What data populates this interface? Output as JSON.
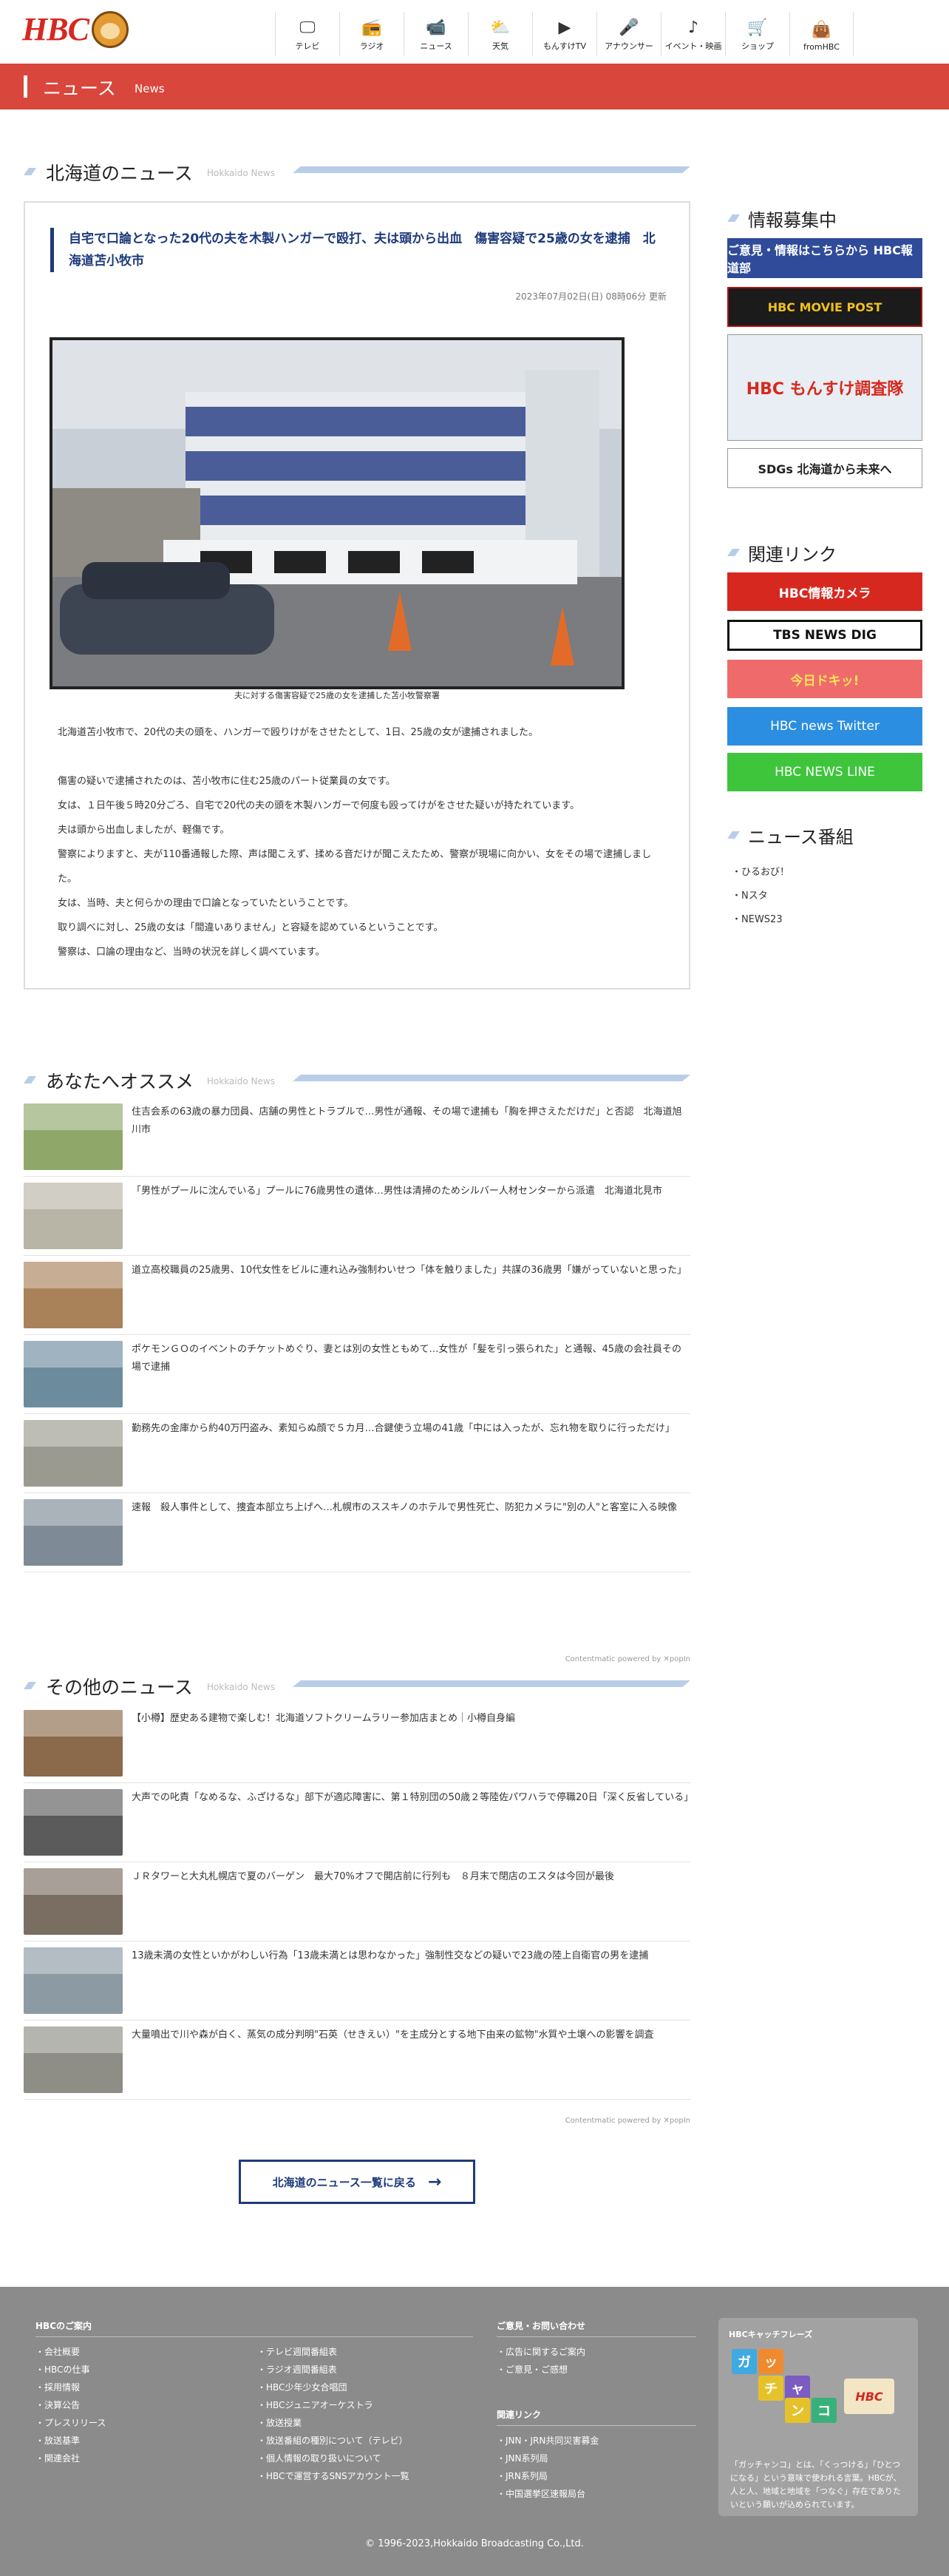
{
  "header": {
    "logo_text": "HBC",
    "nav": [
      {
        "label": "テレビ",
        "icon": "tv-icon",
        "glyph": "🖵"
      },
      {
        "label": "ラジオ",
        "icon": "radio-icon",
        "glyph": "📻"
      },
      {
        "label": "ニュース",
        "icon": "video-camera-icon",
        "glyph": "📹"
      },
      {
        "label": "天気",
        "icon": "weather-icon",
        "glyph": "⛅"
      },
      {
        "label": "もんすけTV",
        "icon": "play-icon",
        "glyph": "▶"
      },
      {
        "label": "アナウンサー",
        "icon": "microphone-icon",
        "glyph": "🎤"
      },
      {
        "label": "イベント・映画",
        "icon": "music-note-icon",
        "glyph": "♪"
      },
      {
        "label": "ショップ",
        "icon": "cart-icon",
        "glyph": "🛒"
      },
      {
        "label": "fromHBC",
        "icon": "bag-icon",
        "glyph": "👜"
      }
    ]
  },
  "title_bar": {
    "title": "ニュース",
    "subtitle": "News"
  },
  "hokkaido_section": {
    "title": "北海道のニュース",
    "subtitle": "Hokkaido News"
  },
  "article": {
    "title": "自宅で口論となった20代の夫を木製ハンガーで殴打、夫は頭から出血　傷害容疑で25歳の女を逮捕　北海道苫小牧市",
    "date": "2023年07月02日(日) 08時06分 更新",
    "caption": "夫に対する傷害容疑で25歳の女を逮捕した苫小牧警察署",
    "paragraphs": [
      "北海道苫小牧市で、20代の夫の頭を、ハンガーで殴りけがをさせたとして、1日、25歳の女が逮捕されました。",
      "",
      "傷害の疑いで逮捕されたのは、苫小牧市に住む25歳のパート従業員の女です。",
      "女は、１日午後５時20分ごろ、自宅で20代の夫の頭を木製ハンガーで何度も殴ってけがをさせた疑いが持たれています。",
      "夫は頭から出血しましたが、軽傷です。",
      "警察によりますと、夫が110番通報した際、声は聞こえず、揉める音だけが聞こえたため、警察が現場に向かい、女をその場で逮捕しました。",
      "女は、当時、夫と何らかの理由で口論となっていたということです。",
      "取り調べに対し、25歳の女は「間違いありません」と容疑を認めているということです。",
      "警察は、口論の理由など、当時の状況を詳しく調べています。"
    ]
  },
  "recommend_section": {
    "title": "あなたへオススメ",
    "subtitle": "Hokkaido News"
  },
  "recommend": [
    {
      "text": "住吉会系の63歳の暴力団員、店舗の男性とトラブルで…男性が通報、その場で逮捕も「胸を押さえただけだ」と否認　北海道旭川市",
      "color": "#8fa86a"
    },
    {
      "text": "「男性がプールに沈んでいる」プールに76歳男性の遺体…男性は清掃のためシルバー人材センターから派遣　北海道北見市",
      "color": "#b8b4a6"
    },
    {
      "text": "道立高校職員の25歳男、10代女性をビルに連れ込み強制わいせつ「体を触りました」共謀の36歳男「嫌がっていないと思った」",
      "color": "#a9825a"
    },
    {
      "text": "ポケモンＧＯのイベントのチケットめぐり、妻とは別の女性ともめて…女性が「髪を引っ張られた」と通報、45歳の会社員その場で逮捕",
      "color": "#6c8c9e"
    },
    {
      "text": "勤務先の金庫から約40万円盗み、素知らぬ顔で５カ月…合鍵使う立場の41歳「中には入ったが、忘れ物を取りに行っただけ」",
      "color": "#9a9a90"
    },
    {
      "text": "速報　殺人事件として、捜査本部立ち上げへ…札幌市のススキノのホテルで男性死亡、防犯カメラに\"別の人\"と客室に入る映像",
      "color": "#7e8a96"
    }
  ],
  "credit_text": "Contentmatic powered by ✕popIn",
  "other_section": {
    "title": "その他のニュース",
    "subtitle": "Hokkaido News"
  },
  "other": [
    {
      "text": "【小樽】歴史ある建物で楽しむ！北海道ソフトクリームラリー参加店まとめ｜小樽自身編",
      "color": "#8a6a4a"
    },
    {
      "text": "大声での叱責「なめるな、ふざけるな」部下が適応障害に、第１特別団の50歳２等陸佐パワハラで停職20日「深く反省している」",
      "color": "#5b5b5b"
    },
    {
      "text": "ＪＲタワーと大丸札幌店で夏のバーゲン　最大70%オフで開店前に行列も　８月末で閉店のエスタは今回が最後",
      "color": "#7a6e62"
    },
    {
      "text": "13歳未満の女性といかがわしい行為「13歳未満とは思わなかった」強制性交などの疑いで23歳の陸上自衛官の男を逮捕",
      "color": "#8c9aa3"
    },
    {
      "text": "大量噴出で川や森が白く、蒸気の成分判明\"石英（せきえい）\"を主成分とする地下由来の鉱物\"水質や土壌への影響を調査",
      "color": "#8e8e86"
    }
  ],
  "back_button": "北海道のニュース一覧に戻る",
  "sidebar": {
    "info_title": "情報募集中",
    "banners": [
      {
        "text": "ご意見・情報はこちらから HBC報道部",
        "bg": "#2f4b9a",
        "fg": "#ffffff",
        "name": "hbc-newsroom-banner"
      },
      {
        "text": "HBC MOVIE POST",
        "bg": "#1b1b1b",
        "fg": "#f0c020",
        "name": "movie-post-banner"
      },
      {
        "text": "HBC もんすけ調査隊",
        "bg": "#e8eef3",
        "fg": "#d7281f",
        "name": "monsuke-banner"
      },
      {
        "text": "SDGs 北海道から未来へ",
        "bg": "#ffffff",
        "fg": "#222222",
        "name": "sdgs-banner"
      }
    ],
    "related_title": "関連リンク",
    "related": [
      {
        "text": "HBC情報カメラ",
        "bg": "#d7281f",
        "fg": "#ffffff",
        "name": "info-camera-banner"
      },
      {
        "text": "TBS NEWS DIG",
        "bg": "#ffffff",
        "fg": "#111111",
        "name": "tbs-news-dig-banner"
      },
      {
        "text": "今日ドキッ!",
        "bg": "#ef6b6b",
        "fg": "#ffe35a",
        "name": "kyodoki-banner"
      },
      {
        "text": "HBC news Twitter",
        "bg": "#2b8ee0",
        "fg": "#ffffff",
        "name": "twitter-banner"
      },
      {
        "text": "HBC NEWS LINE",
        "bg": "#3ec53c",
        "fg": "#ffffff",
        "name": "line-banner"
      }
    ],
    "programs_title": "ニュース番組",
    "programs": [
      "ひるおび！",
      "Nスタ",
      "NEWS23"
    ]
  },
  "footer": {
    "about_title": "HBCのご案内",
    "about_col1": [
      "会社概要",
      "HBCの仕事",
      "採用情報",
      "決算公告",
      "プレスリリース",
      "放送基準",
      "関連会社"
    ],
    "about_col2": [
      "テレビ週間番組表",
      "ラジオ週間番組表",
      "HBC少年少女合唱団",
      "HBCジュニアオーケストラ",
      "放送授業",
      "放送番組の種別について（テレビ）",
      "個人情報の取り扱いについて",
      "HBCで運営するSNSアカウント一覧"
    ],
    "contact_title": "ご意見・お問い合わせ",
    "contact": [
      "広告に関するご案内",
      "ご意見・ご感想"
    ],
    "links_title": "関連リンク",
    "links": [
      "JNN・JRN共同災害募金",
      "JNN系列局",
      "JRN系列局",
      "中国選挙区速報局台"
    ],
    "catch_title": "HBCキャッチフレーズ",
    "catch_words": [
      "ガ",
      "ッ",
      "チ",
      "ャ",
      "ン",
      "コ"
    ],
    "catch_logo": "HBC",
    "catch_text": "「ガッチャンコ」とは、「くっつける」「ひとつになる」という意味で使われる言葉。HBCが、人と人、地域と地域を「つなぐ」存在でありたいという願いが込められています。",
    "copyright": "© 1996-2023,Hokkaido Broadcasting Co.,Ltd."
  }
}
